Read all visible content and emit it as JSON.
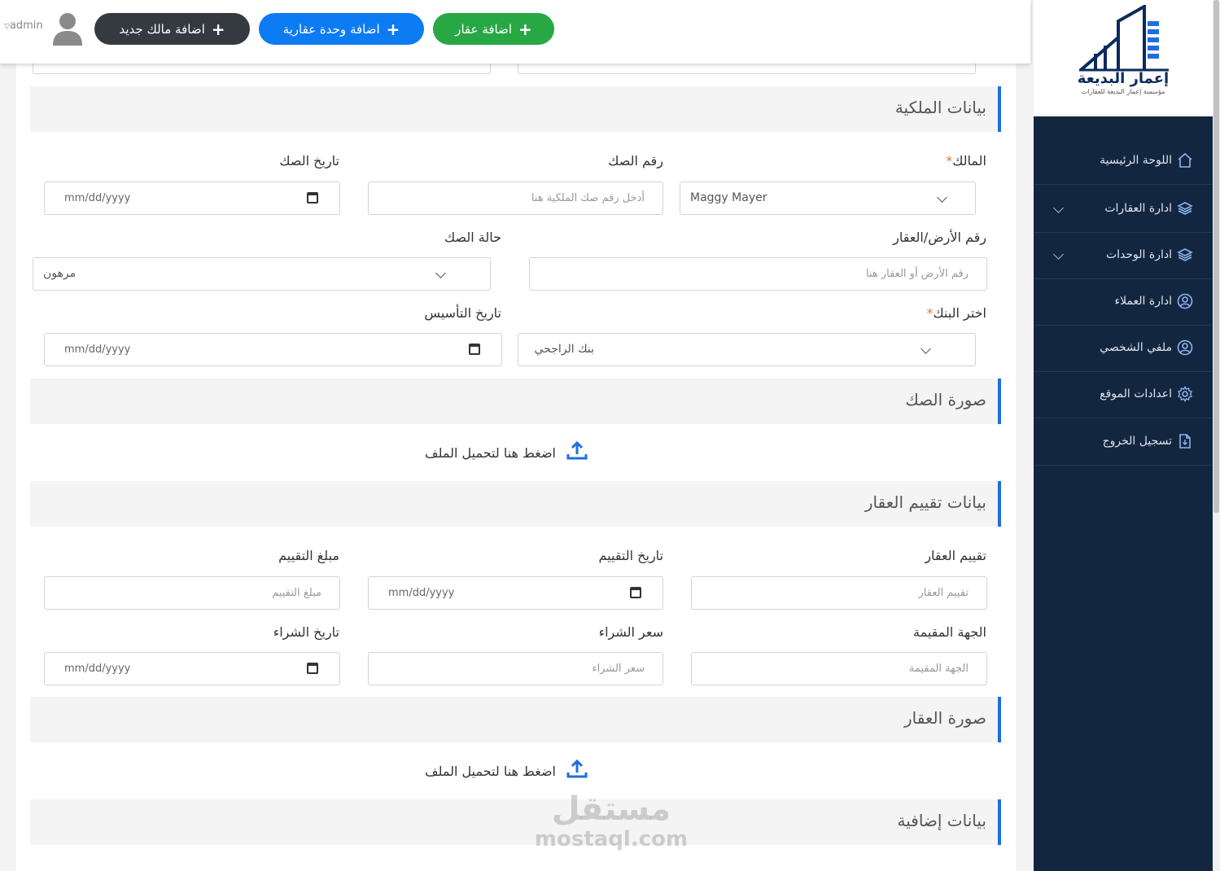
{
  "topbar": {
    "user": "admin",
    "add_owner": "اضافة مالك جديد",
    "add_unit": "اضافة وحدة عقارية",
    "add_property": "اضافة عقار"
  },
  "logo": {
    "name": "إعمار البديعة",
    "tagline": "مؤسسة إعمار البديعة للعقارات"
  },
  "sidebar": {
    "items": [
      {
        "label": "اللوحة الرئيسية",
        "icon": "home-icon"
      },
      {
        "label": "ادارة العقارات",
        "icon": "layers-icon"
      },
      {
        "label": "ادارة الوحدات",
        "icon": "layers-icon"
      },
      {
        "label": "ادارة العملاء",
        "icon": "user-circle-icon"
      },
      {
        "label": "ملفي الشخصي",
        "icon": "user-circle-icon"
      },
      {
        "label": "اعدادات الموقع",
        "icon": "gear-icon"
      },
      {
        "label": "تسجيل الخروج",
        "icon": "logout-file-icon"
      }
    ]
  },
  "colors": {
    "accent": "#1d6fe0",
    "sidebar": "#132640",
    "green": "#28a745",
    "blue": "#0d7bf2",
    "dark": "#343a40"
  },
  "ownership": {
    "title": "بيانات الملكية",
    "owner_label": "المالك",
    "owner_value": "Maggy Mayer",
    "deed_no_label": "رقم الصك",
    "deed_no_placeholder": "أدخل رقم صك الملكية هنا",
    "deed_date_label": "تاريخ الصك",
    "date_placeholder": "mm/dd/yyyy",
    "land_no_label": "رقم الأرض/العقار",
    "land_no_placeholder": "رقم الأرض أو العقار هنا",
    "deed_status_label": "حالة الصك",
    "deed_status_value": "مرهون",
    "bank_label": "اختر البنك",
    "bank_value": "بنك الراجحي",
    "founding_date_label": "تاريخ التأسيس"
  },
  "deed_image": {
    "title": "صورة الصك",
    "upload": "اضغط هنا لتحميل الملف"
  },
  "valuation": {
    "title": "بيانات تقييم العقار",
    "valuation_label": "تقييم العقار",
    "valuation_placeholder": "تقييم العقار",
    "valuation_date_label": "تاريخ التقييم",
    "amount_label": "مبلغ التقييم",
    "amount_placeholder": "مبلغ التقييم",
    "evaluator_label": "الجهة المقيمة",
    "evaluator_placeholder": "الجهة المقيمة",
    "price_label": "سعر الشراء",
    "price_placeholder": "سعر الشراء",
    "purchase_date_label": "تاريخ الشراء"
  },
  "property_image": {
    "title": "صورة العقار",
    "upload": "اضغط هنا لتحميل الملف"
  },
  "extra": {
    "title": "بيانات إضافية"
  },
  "watermark": {
    "arabic": "مستقل",
    "latin": "mostaql.com"
  }
}
